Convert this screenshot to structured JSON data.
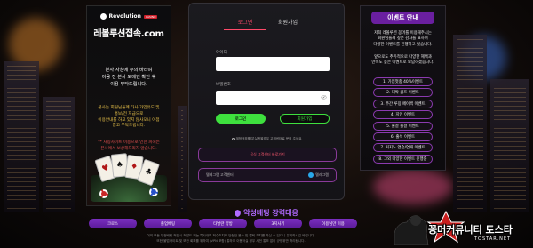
{
  "brand": {
    "logo_text": "Revolution",
    "logo_tag": "CASINO",
    "site_name": "레볼루션접속.com"
  },
  "left_banner": {
    "notice_main": [
      "본사 사칭에 주의 바라며",
      "이용 전 본사 도메인 확인 후",
      "이용 부탁드립니다."
    ],
    "notice_yellow": [
      "본사는 회원님들께 타사 가입유도 및",
      "홍보/전 지급으로",
      "이용안내를 하고 있지 않사오니 이점",
      "참고 부탁드립니다."
    ],
    "notice_red": [
      "** 사칭사이트 이용으로 인한 피해는",
      "본사에서 보상해드리지 않습니다."
    ]
  },
  "login": {
    "tab_login": "로그인",
    "tab_join": "회원가입",
    "id_label": "아이디",
    "id_value": "",
    "pw_label": "비밀번호",
    "pw_value": "",
    "login_button": "로그인",
    "join_button": "회원가입",
    "hint": "계정정보를 분실했을경우 고객센터로 문의 주세요",
    "line_button_1": "공식 고객센터 바로가기",
    "line_button_2_left": "텔레그램 고객센터",
    "line_button_2_right": "텔레그램"
  },
  "events": {
    "title": "이벤트 안내",
    "desc_1": [
      "저희 레볼루션 꽁머를 이용해주시는",
      "회원님들께 깊은 감사를 표하며",
      "다양한 이벤트를 진행하고 있습니다."
    ],
    "desc_2": [
      "앞으로도 추가적으로 다양한 혜택과",
      "만족도 높은 이벤트로 보답하겠습니다."
    ],
    "items": [
      "1. 가입첫충 40%이벤트",
      "2. 대박 콤프 이벤트",
      "3. 주간 루징 페이백 이벤트",
      "4. 지인 이벤트",
      "5. 출결 출결 이벤트",
      "6. 출석 이벤트",
      "7. 커지노 연승/연패 이벤트",
      "8. 그외 다양한 이벤트 진행중"
    ]
  },
  "bottom": {
    "title": "악성배팅 강력대응",
    "menu": [
      "크로스",
      "졸업베팅",
      "타발란 양방",
      "3지사기",
      "이용님만 이용",
      "기타 악성배팅"
    ],
    "footer": [
      "이외 모든 부정배팅 적발시 적발도 되는 특사내역 회수조치와 당첨금 몰수 및 탈퇴 조치를 하실 수 있으니 유의하시길 바랍니다.",
      "또한 불법사이트 및 보안 회피를 위하여 (VPN 포함) 통하여 이용하실 경우 사전 통보 없이 규정위반 처리됩니다."
    ]
  },
  "watermark": {
    "text": "꽁머커뮤니티 토스타",
    "sub": "TOSTAR.NET"
  }
}
